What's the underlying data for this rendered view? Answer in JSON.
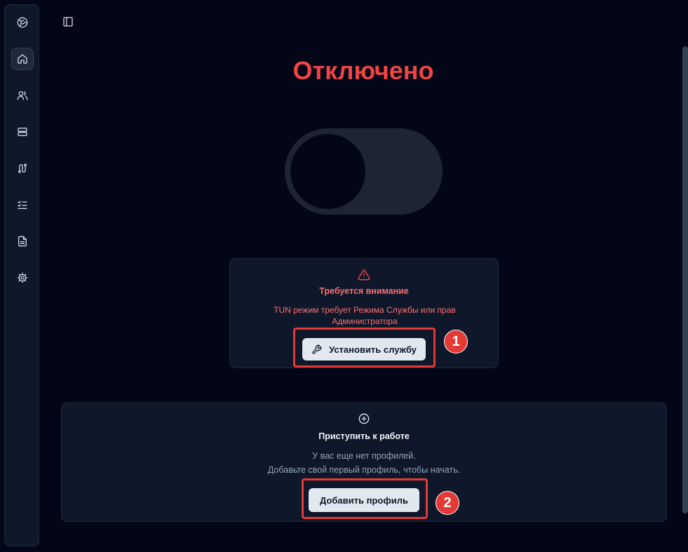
{
  "sidebar": {
    "items": [
      {
        "icon": "globe-icon",
        "active": false
      },
      {
        "icon": "home-icon",
        "active": true
      },
      {
        "icon": "users-icon",
        "active": false
      },
      {
        "icon": "server-icon",
        "active": false
      },
      {
        "icon": "route-icon",
        "active": false
      },
      {
        "icon": "list-checks-icon",
        "active": false
      },
      {
        "icon": "file-text-icon",
        "active": false
      },
      {
        "icon": "settings-icon",
        "active": false
      }
    ]
  },
  "status": {
    "title": "Отключено",
    "title_color": "#ef4444"
  },
  "warning": {
    "title": "Требуется внимание",
    "description": "TUN режим требует Режима Службы или прав Администратора",
    "button_label": "Установить службу",
    "badge": "1"
  },
  "getting_started": {
    "title": "Приступить к работе",
    "line1": "У вас еще нет профилей.",
    "line2": "Добавьте свой первый профиль, чтобы начать.",
    "button_label": "Добавить профиль",
    "badge": "2"
  },
  "colors": {
    "background": "#020617",
    "card": "#0f172a",
    "accent_red": "#e53935"
  }
}
